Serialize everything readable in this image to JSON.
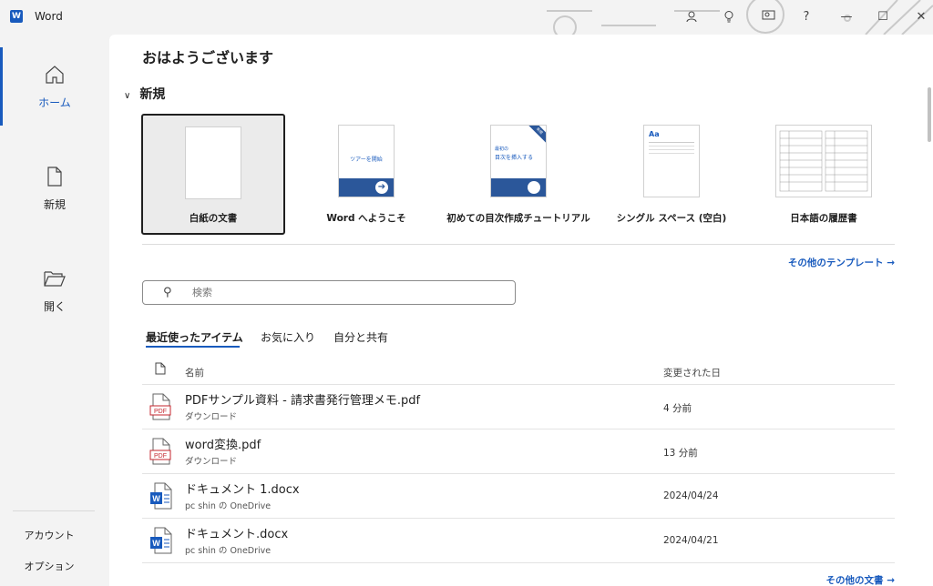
{
  "titlebar": {
    "app_name": "Word",
    "help_label": "?",
    "minimize_label": "—",
    "maximize_label": "☐",
    "close_label": "✕"
  },
  "nav": {
    "home": "ホーム",
    "new": "新規",
    "open": "開く",
    "account": "アカウント",
    "options": "オプション"
  },
  "main": {
    "greeting": "おはようございます",
    "new_section": "新規",
    "templates": [
      {
        "label": "白紙の文書"
      },
      {
        "label": "Word へようこそ",
        "thumb_text": "ツアーを開始"
      },
      {
        "label": "初めての目次作成チュートリアル",
        "thumb_text": "目次を挿入する",
        "thumb_small": "新規",
        "thumb_top": "最初の"
      },
      {
        "label": "シングル スペース (空白)",
        "thumb_text": "Aa"
      },
      {
        "label": "日本語の履歴書"
      }
    ],
    "more_templates": "その他のテンプレート →",
    "search_placeholder": "検索",
    "tabs": [
      "最近使ったアイテム",
      "お気に入り",
      "自分と共有"
    ],
    "columns": {
      "name": "名前",
      "modified": "変更された日"
    },
    "files": [
      {
        "name": "PDFサンプル資料 - 請求書発行管理メモ.pdf",
        "location": "ダウンロード",
        "date": "4 分前",
        "type": "pdf",
        "icon_text": "PDF"
      },
      {
        "name": "word変換.pdf",
        "location": "ダウンロード",
        "date": "13 分前",
        "type": "pdf",
        "icon_text": "PDF"
      },
      {
        "name": "ドキュメント 1.docx",
        "location": "pc shin の OneDrive",
        "date": "2024/04/24",
        "type": "word",
        "icon_text": "W"
      },
      {
        "name": "ドキュメント.docx",
        "location": "pc shin の OneDrive",
        "date": "2024/04/21",
        "type": "word",
        "icon_text": "W"
      }
    ],
    "more_documents": "その他の文書 →"
  },
  "colors": {
    "accent": "#185abd",
    "pdf_red": "#c4262e"
  }
}
